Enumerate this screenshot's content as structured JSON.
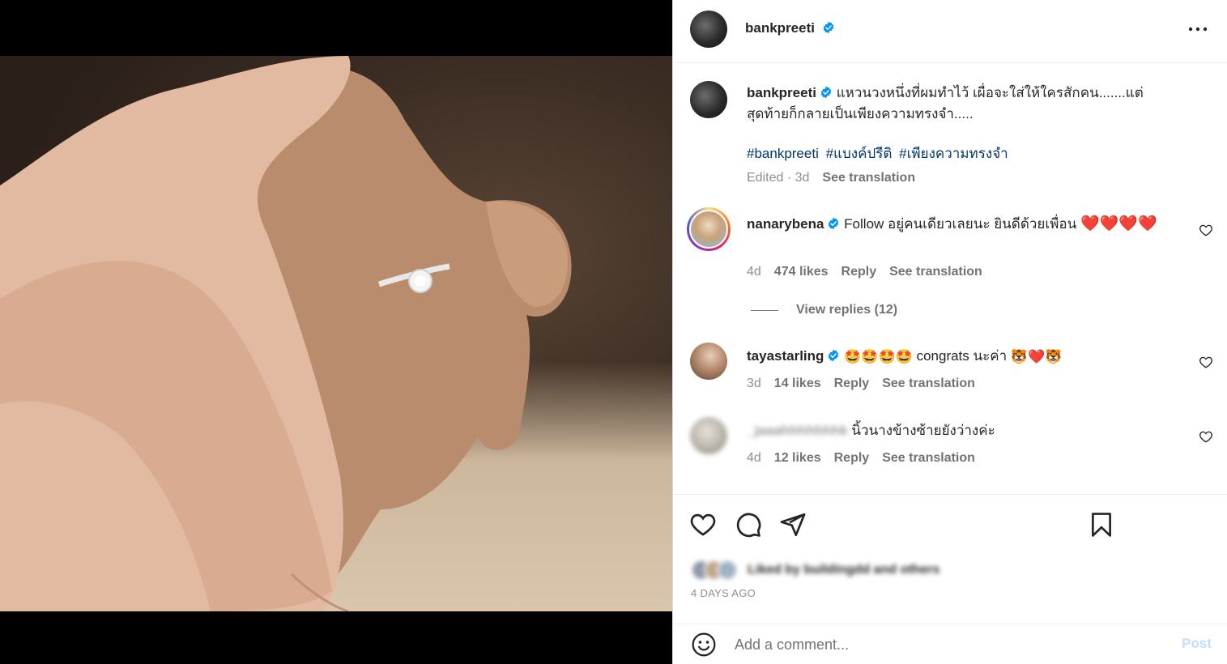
{
  "post": {
    "author": "bankpreeti",
    "caption_line1": "แหวนวงหนึ่งที่ผมทำไว้ เผื่อจะใส่ให้ใครสักคน.......แต่",
    "caption_line2": "สุดท้ายก็กลายเป็นเพียงความทรงจำ.....",
    "hashtags": [
      "#bankpreeti",
      "#แบงค์ปรีติ",
      "#เพียงความทรงจำ"
    ],
    "edited": "Edited · 3d",
    "see_translation": "See translation"
  },
  "comments": [
    {
      "user": "nanarybena",
      "text": "Follow อยู่คนเดียวเลยนะ ยินดีด้วยเพื่อน",
      "emoji_suffix": "❤️❤️❤️❤️",
      "age": "4d",
      "likes": "474 likes",
      "reply": "Reply",
      "see_translation": "See translation",
      "view_replies": "View replies (12)"
    },
    {
      "user": "tayastarling",
      "emoji_prefix": "🤩🤩🤩🤩",
      "text": "congrats นะค่า",
      "emoji_suffix": "🐯❤️🐯",
      "age": "3d",
      "likes": "14 likes",
      "reply": "Reply",
      "see_translation": "See translation"
    },
    {
      "user": "_jaaahhhhhhhk",
      "text": "นิ้วนางข้างซ้ายยังว่างค่ะ",
      "age": "4d",
      "likes": "12 likes",
      "reply": "Reply",
      "see_translation": "See translation"
    }
  ],
  "likes_summary": {
    "text": "Liked by buildingdd and others",
    "date": "4 DAYS AGO"
  },
  "add_comment": {
    "placeholder": "Add a comment...",
    "post_label": "Post"
  },
  "colors": {
    "link": "#00376b",
    "verified": "#0095f6",
    "secondary": "#737373",
    "post_disabled": "#c0dffd"
  },
  "icons": [
    "more-icon",
    "verified-icon",
    "heart-icon",
    "comment-icon",
    "share-icon",
    "bookmark-icon",
    "emoji-icon"
  ]
}
